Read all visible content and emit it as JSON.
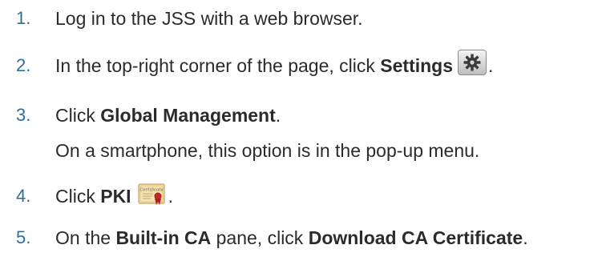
{
  "steps": [
    {
      "number": "1.",
      "parts": [
        "Log in to the JSS with a web browser."
      ]
    },
    {
      "number": "2.",
      "prefix": "In the top-right corner of the page, click ",
      "bold": "Settings",
      "icon": "settings-gear-icon",
      "suffix": "."
    },
    {
      "number": "3.",
      "prefix": "Click ",
      "bold": "Global Management",
      "suffix": ".",
      "note": "On a smartphone, this option is in the pop-up menu."
    },
    {
      "number": "4.",
      "prefix": "Click ",
      "bold": "PKI",
      "icon": "certificate-icon",
      "suffix": "."
    },
    {
      "number": "5.",
      "prefix": "On the ",
      "bold": "Built-in CA",
      "middle": " pane, click ",
      "bold2": "Download CA Certificate",
      "suffix": "."
    }
  ],
  "icons": {
    "certificate_label": "Certificate"
  },
  "colors": {
    "step_number": "#2f6e9a",
    "text": "#2b2b2b"
  }
}
